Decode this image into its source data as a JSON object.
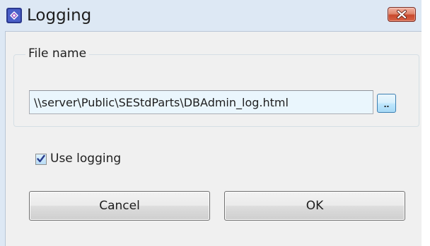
{
  "window": {
    "title": "Logging",
    "icon": "app-icon",
    "close_icon": "close-icon"
  },
  "file_group": {
    "label": "File name",
    "file_path": "\\\\server\\Public\\SEStdParts\\DBAdmin_log.html",
    "browse_label": ".."
  },
  "options": {
    "use_logging_label": "Use logging",
    "use_logging_checked": true
  },
  "buttons": {
    "cancel_label": "Cancel",
    "ok_label": "OK"
  },
  "colors": {
    "frame": "#dde8f4",
    "client": "#f0f0f0",
    "close_button": "#c8482c",
    "input_background": "#eaf6fd"
  }
}
